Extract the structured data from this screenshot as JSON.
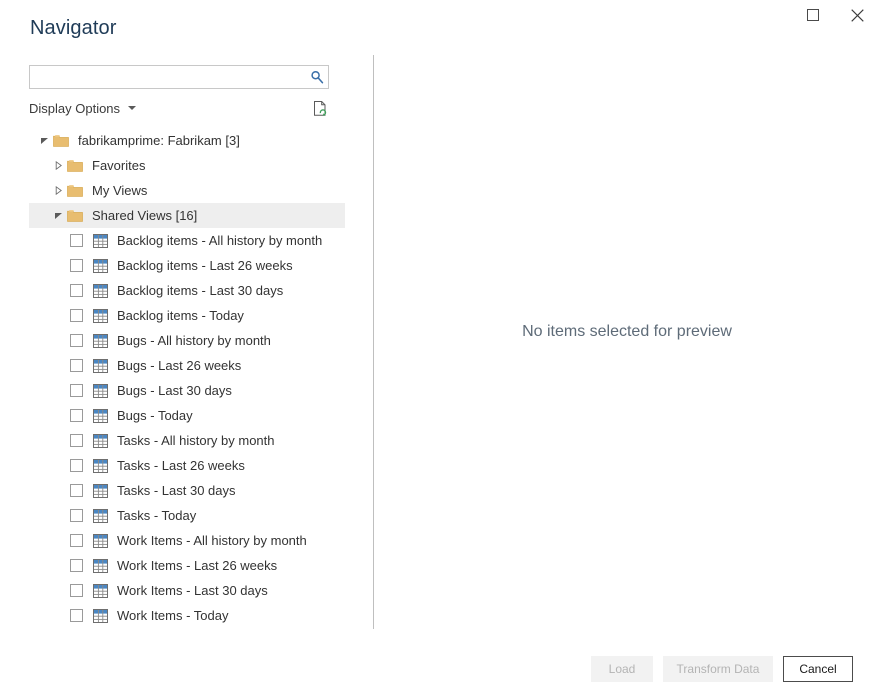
{
  "window": {
    "title": "Navigator",
    "controls": [
      {
        "name": "maximize-button",
        "icon": "maximize-icon",
        "label": ""
      },
      {
        "name": "close-button",
        "icon": "close-icon",
        "label": ""
      }
    ]
  },
  "search": {
    "value": "",
    "placeholder": "",
    "icon": "search-icon"
  },
  "options": {
    "display_options_label": "Display Options",
    "caret_icon": "chevron-down-icon",
    "refresh_icon": "refresh-preview-icon"
  },
  "tree": {
    "nodes": [
      {
        "label": "fabrikamprime: Fabrikam [3]",
        "type": "folder",
        "level": 0,
        "expanded": true,
        "selected": false
      },
      {
        "label": "Favorites",
        "type": "folder",
        "level": 1,
        "expanded": false,
        "selected": false
      },
      {
        "label": "My Views",
        "type": "folder",
        "level": 1,
        "expanded": false,
        "selected": false
      },
      {
        "label": "Shared Views [16]",
        "type": "folder",
        "level": 1,
        "expanded": true,
        "selected": true
      },
      {
        "label": "Backlog items - All history by month",
        "type": "table",
        "level": 2,
        "checked": false
      },
      {
        "label": "Backlog items - Last 26 weeks",
        "type": "table",
        "level": 2,
        "checked": false
      },
      {
        "label": "Backlog items - Last 30 days",
        "type": "table",
        "level": 2,
        "checked": false
      },
      {
        "label": "Backlog items - Today",
        "type": "table",
        "level": 2,
        "checked": false
      },
      {
        "label": "Bugs - All history by month",
        "type": "table",
        "level": 2,
        "checked": false
      },
      {
        "label": "Bugs - Last 26 weeks",
        "type": "table",
        "level": 2,
        "checked": false
      },
      {
        "label": "Bugs - Last 30 days",
        "type": "table",
        "level": 2,
        "checked": false
      },
      {
        "label": "Bugs - Today",
        "type": "table",
        "level": 2,
        "checked": false
      },
      {
        "label": "Tasks - All history by month",
        "type": "table",
        "level": 2,
        "checked": false
      },
      {
        "label": "Tasks - Last 26 weeks",
        "type": "table",
        "level": 2,
        "checked": false
      },
      {
        "label": "Tasks - Last 30 days",
        "type": "table",
        "level": 2,
        "checked": false
      },
      {
        "label": "Tasks - Today",
        "type": "table",
        "level": 2,
        "checked": false
      },
      {
        "label": "Work Items - All history by month",
        "type": "table",
        "level": 2,
        "checked": false
      },
      {
        "label": "Work Items - Last 26 weeks",
        "type": "table",
        "level": 2,
        "checked": false
      },
      {
        "label": "Work Items - Last 30 days",
        "type": "table",
        "level": 2,
        "checked": false
      },
      {
        "label": "Work Items - Today",
        "type": "table",
        "level": 2,
        "checked": false
      }
    ]
  },
  "preview": {
    "empty_message": "No items selected for preview"
  },
  "footer": {
    "load_label": "Load",
    "transform_label": "Transform Data",
    "cancel_label": "Cancel",
    "load_enabled": false,
    "transform_enabled": false,
    "cancel_enabled": true
  },
  "colors": {
    "title_text": "#1f3b57",
    "folder": "#e8bd70",
    "accent_blue": "#3a6fa8",
    "selected_row": "#eeeeee",
    "preview_text": "#5e6b78",
    "disabled_button_bg": "#f2f2f2"
  }
}
